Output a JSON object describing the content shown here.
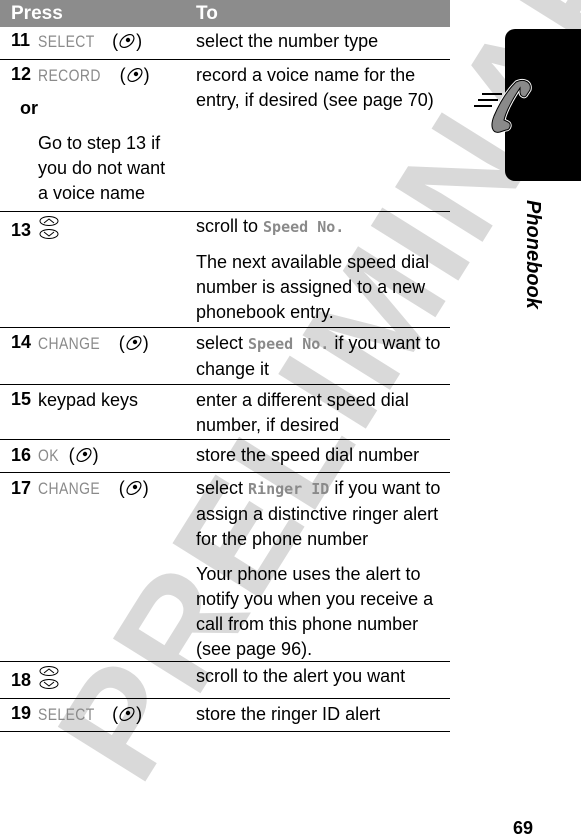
{
  "header": {
    "col_press": "Press",
    "col_to": "To"
  },
  "section_tab": {
    "label": "Phonebook",
    "icon": "phone-handset-icon"
  },
  "watermark": "PRELIMINARY",
  "page_number": "69",
  "rows": [
    {
      "step": "11",
      "press_softkey": "SELECT",
      "press_key": "softkey-icon",
      "to": [
        "select the number type"
      ]
    },
    {
      "step": "12",
      "press_softkey": "RECORD",
      "press_key": "softkey-icon",
      "or_label": "or",
      "alt_press": "Go to step 13 if you do not want a voice name",
      "to": [
        "record a voice name for the entry, if desired (see page 70)"
      ]
    },
    {
      "step": "13",
      "press_icon": "scroll-up-down-icon",
      "to_prefix": "scroll to ",
      "to_lcd": "Speed No.",
      "to_extra": "The next available speed dial number is assigned to a new phonebook entry."
    },
    {
      "step": "14",
      "press_softkey": "CHANGE",
      "press_key": "softkey-icon",
      "to_prefix": "select ",
      "to_lcd": "Speed No.",
      "to_suffix": " if you want to change it"
    },
    {
      "step": "15",
      "press_text": "keypad keys",
      "to": [
        "enter a different speed dial number, if desired"
      ]
    },
    {
      "step": "16",
      "press_softkey": "OK",
      "press_key": "softkey-icon",
      "to": [
        "store the speed dial number"
      ]
    },
    {
      "step": "17",
      "press_softkey": "CHANGE",
      "press_key": "softkey-icon",
      "to_prefix": "select ",
      "to_lcd": "Ringer ID",
      "to_suffix": " if you want to assign a distinctive ringer alert for the phone number",
      "to_extra": "Your phone uses the alert to notify you when you receive a call from this phone number (see page 96)."
    },
    {
      "step": "18",
      "press_icon": "scroll-up-down-icon",
      "to": [
        "scroll to the alert you want"
      ]
    },
    {
      "step": "19",
      "press_softkey": "SELECT",
      "press_key": "softkey-icon",
      "to": [
        "store the ringer ID alert"
      ]
    }
  ]
}
